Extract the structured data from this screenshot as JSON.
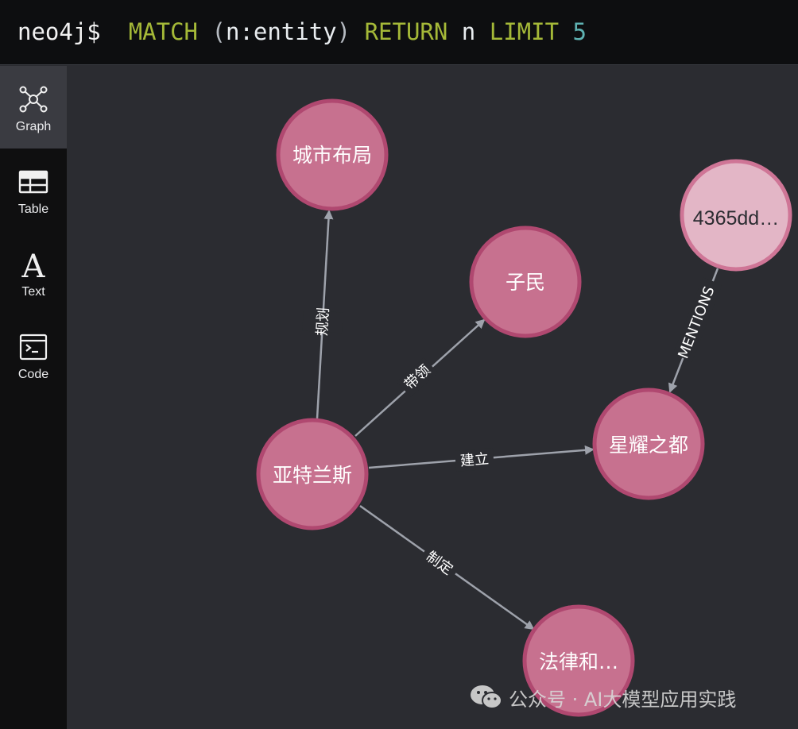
{
  "query": {
    "prompt": "neo4j$",
    "match_kw": "MATCH",
    "open_paren": "(",
    "pattern": "n:entity",
    "close_paren": ")",
    "return_kw": "RETURN",
    "return_var": "n",
    "limit_kw": "LIMIT",
    "limit_value": "5"
  },
  "sidebar": {
    "items": [
      {
        "label": "Graph",
        "icon": "graph-icon",
        "active": true
      },
      {
        "label": "Table",
        "icon": "table-icon",
        "active": false
      },
      {
        "label": "Text",
        "icon": "text-icon",
        "active": false
      },
      {
        "label": "Code",
        "icon": "code-icon",
        "active": false
      }
    ]
  },
  "graph": {
    "node_fill": "#c7718f",
    "node_stroke": "#b04870",
    "node_fill_light": "#e3b6c6",
    "node_stroke_light": "#cf7596",
    "edge_color": "#9ea2ab",
    "nodes": [
      {
        "id": "city",
        "label": "城市布局"
      },
      {
        "id": "people",
        "label": "子民"
      },
      {
        "id": "doc",
        "label": "4365dd…"
      },
      {
        "id": "atlantis",
        "label": "亚特兰斯"
      },
      {
        "id": "star",
        "label": "星耀之都"
      },
      {
        "id": "law",
        "label": "法律和…"
      }
    ],
    "relationships": [
      {
        "from": "atlantis",
        "to": "city",
        "label": "规划"
      },
      {
        "from": "atlantis",
        "to": "people",
        "label": "带领"
      },
      {
        "from": "atlantis",
        "to": "star",
        "label": "建立"
      },
      {
        "from": "atlantis",
        "to": "law",
        "label": "制定"
      },
      {
        "from": "doc",
        "to": "star",
        "label": "MENTIONS"
      }
    ]
  },
  "watermark": {
    "text": "公众号 · AI大模型应用实践",
    "icon": "wechat-icon"
  }
}
